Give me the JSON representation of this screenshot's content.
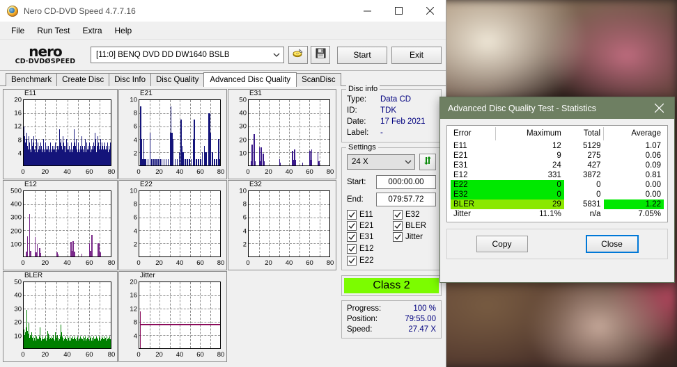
{
  "window": {
    "title": "Nero CD-DVD Speed 4.7.7.16",
    "icon": "nero-logo-icon",
    "controls": {
      "minimize": "minimize-icon",
      "maximize": "maximize-icon",
      "close": "close-icon"
    }
  },
  "menubar": {
    "items": [
      "File",
      "Run Test",
      "Extra",
      "Help"
    ]
  },
  "toolbar": {
    "logo_main": "nero",
    "logo_sub": "CD·DVDØSPEED",
    "drive": "[11:0]   BENQ DVD DD DW1640 BSLB",
    "eject_icon": "eject-disc-icon",
    "save_icon": "floppy-save-icon",
    "start_label": "Start",
    "exit_label": "Exit"
  },
  "tabs": {
    "items": [
      "Benchmark",
      "Create Disc",
      "Disc Info",
      "Disc Quality",
      "Advanced Disc Quality",
      "ScanDisc"
    ],
    "active": "Advanced Disc Quality"
  },
  "disc_info": {
    "legend": "Disc info",
    "rows": [
      {
        "key": "Type:",
        "value": "Data CD"
      },
      {
        "key": "ID:",
        "value": "TDK"
      },
      {
        "key": "Date:",
        "value": "17 Feb 2021"
      },
      {
        "key": "Label:",
        "value": "-"
      }
    ]
  },
  "settings": {
    "legend": "Settings",
    "speed": "24 X",
    "refresh_icon": "refresh-arrows-icon",
    "start_label": "Start:",
    "start_value": "000:00.00",
    "end_label": "End:",
    "end_value": "079:57.72",
    "checkboxes": [
      {
        "label": "E11",
        "checked": true
      },
      {
        "label": "E32",
        "checked": true
      },
      {
        "label": "E21",
        "checked": true
      },
      {
        "label": "BLER",
        "checked": true
      },
      {
        "label": "E31",
        "checked": true
      },
      {
        "label": "Jitter",
        "checked": true
      },
      {
        "label": "E12",
        "checked": true
      },
      {
        "label": "",
        "checked": null
      },
      {
        "label": "E22",
        "checked": true
      },
      {
        "label": "",
        "checked": null
      }
    ]
  },
  "class_badge": {
    "text": "Class 2",
    "color": "#7cfc00"
  },
  "progress": {
    "rows": [
      {
        "key": "Progress:",
        "value": "100 %"
      },
      {
        "key": "Position:",
        "value": "79:55.00"
      },
      {
        "key": "Speed:",
        "value": "27.47 X"
      }
    ]
  },
  "statistics_dialog": {
    "title": "Advanced Disc Quality Test - Statistics",
    "title_color": "#6e7f62",
    "close_icon": "close-icon",
    "columns": [
      "Error",
      "Maximum",
      "Total",
      "Average"
    ],
    "rows": [
      {
        "error": "E11",
        "maximum": "12",
        "total": "5129",
        "average": "1.07",
        "highlight": "none"
      },
      {
        "error": "E21",
        "maximum": "9",
        "total": "275",
        "average": "0.06",
        "highlight": "none"
      },
      {
        "error": "E31",
        "maximum": "24",
        "total": "427",
        "average": "0.09",
        "highlight": "none"
      },
      {
        "error": "E12",
        "maximum": "331",
        "total": "3872",
        "average": "0.81",
        "highlight": "none"
      },
      {
        "error": "E22",
        "maximum": "0",
        "total": "0",
        "average": "0.00",
        "highlight": "green-left"
      },
      {
        "error": "E32",
        "maximum": "0",
        "total": "0",
        "average": "0.00",
        "highlight": "green-left"
      },
      {
        "error": "BLER",
        "maximum": "29",
        "total": "5831",
        "average": "1.22",
        "highlight": "yellowgreen-left-green-avg"
      },
      {
        "error": "Jitter",
        "maximum": "11.1%",
        "total": "n/a",
        "average": "7.05%",
        "highlight": "none"
      }
    ],
    "copy_label": "Copy",
    "close_label": "Close",
    "colors": {
      "green": "#00e800",
      "yellow_green": "#8ae800"
    }
  },
  "chart_data": [
    {
      "type": "bar",
      "title": "E11",
      "xlabel": "",
      "ylabel": "",
      "ylim": [
        0,
        20
      ],
      "yticks": [
        4,
        8,
        12,
        16,
        20
      ],
      "xlim": [
        0,
        80
      ],
      "xticks": [
        0,
        20,
        40,
        60,
        80
      ],
      "color": "#14147a",
      "grid": true,
      "style": "dense-fill",
      "values": [
        12,
        9,
        7,
        5,
        8,
        10,
        6,
        5,
        9,
        7,
        6,
        5,
        4,
        8,
        6,
        5,
        7,
        9,
        5,
        4,
        6,
        8,
        5,
        4,
        7,
        5,
        6,
        4,
        5,
        7,
        6,
        4,
        5,
        8,
        6,
        5,
        4,
        7,
        5,
        6,
        4,
        5,
        6,
        4,
        5,
        7,
        6,
        4,
        5,
        6,
        5,
        4,
        6,
        5,
        7,
        4,
        5,
        6,
        4,
        5,
        6,
        11,
        7,
        5,
        8,
        6,
        5,
        9,
        7,
        6,
        5,
        4,
        6,
        8,
        5,
        4,
        7,
        5,
        6,
        4,
        5,
        7,
        6,
        4,
        5,
        6,
        11,
        7,
        5,
        6,
        8,
        5,
        4,
        6,
        7,
        5,
        4,
        6,
        5,
        7,
        9,
        6,
        5,
        4,
        6,
        8,
        5,
        4,
        7,
        5,
        6,
        4,
        5,
        7,
        6,
        4,
        5,
        6,
        4,
        5,
        7,
        6,
        10,
        8,
        5,
        4,
        6,
        9,
        7,
        5,
        4,
        6,
        8,
        5,
        7,
        6,
        4,
        5,
        6,
        7,
        5,
        4,
        6,
        5,
        7,
        4,
        6,
        5,
        4,
        7
      ]
    },
    {
      "type": "bar",
      "title": "E21",
      "xlabel": "",
      "ylabel": "",
      "ylim": [
        0,
        10
      ],
      "yticks": [
        2,
        4,
        6,
        8,
        10
      ],
      "xlim": [
        0,
        80
      ],
      "xticks": [
        0,
        20,
        40,
        60,
        80
      ],
      "color": "#14147a",
      "grid": true,
      "style": "sparse-spikes",
      "spikes": [
        [
          1,
          9
        ],
        [
          2,
          4
        ],
        [
          3,
          1
        ],
        [
          4,
          4
        ],
        [
          5,
          1
        ],
        [
          6,
          1
        ],
        [
          8,
          1
        ],
        [
          10,
          5
        ],
        [
          12,
          1
        ],
        [
          14,
          1
        ],
        [
          16,
          1
        ],
        [
          18,
          1
        ],
        [
          20,
          1
        ],
        [
          22,
          1
        ],
        [
          24,
          1
        ],
        [
          26,
          1
        ],
        [
          28,
          1
        ],
        [
          30,
          5
        ],
        [
          31,
          9
        ],
        [
          32,
          5
        ],
        [
          33,
          4
        ],
        [
          35,
          1
        ],
        [
          37,
          1
        ],
        [
          39,
          2
        ],
        [
          41,
          7
        ],
        [
          42,
          3
        ],
        [
          43,
          2
        ],
        [
          45,
          1
        ],
        [
          47,
          1
        ],
        [
          49,
          1
        ],
        [
          51,
          1
        ],
        [
          53,
          4
        ],
        [
          54,
          7
        ],
        [
          56,
          1
        ],
        [
          58,
          1
        ],
        [
          60,
          1
        ],
        [
          62,
          2
        ],
        [
          64,
          3
        ],
        [
          65,
          2
        ],
        [
          66,
          2
        ],
        [
          68,
          8
        ],
        [
          69,
          8
        ],
        [
          70,
          5
        ],
        [
          72,
          2
        ],
        [
          74,
          1
        ],
        [
          76,
          1
        ],
        [
          78,
          4
        ],
        [
          79,
          1
        ]
      ]
    },
    {
      "type": "bar",
      "title": "E31",
      "xlabel": "",
      "ylabel": "",
      "ylim": [
        0,
        50
      ],
      "yticks": [
        10,
        20,
        30,
        40,
        50
      ],
      "xlim": [
        0,
        80
      ],
      "xticks": [
        0,
        20,
        40,
        60,
        80
      ],
      "color": "#3a1a8a",
      "grid": true,
      "style": "sparse-spikes",
      "spikes": [
        [
          2,
          3
        ],
        [
          3,
          16
        ],
        [
          5,
          24
        ],
        [
          6,
          3
        ],
        [
          10,
          14
        ],
        [
          11,
          3
        ],
        [
          12,
          14
        ],
        [
          14,
          9
        ],
        [
          15,
          3
        ],
        [
          30,
          5
        ],
        [
          31,
          2
        ],
        [
          43,
          11
        ],
        [
          44,
          4
        ],
        [
          45,
          12
        ],
        [
          46,
          4
        ],
        [
          53,
          2
        ],
        [
          60,
          11
        ],
        [
          61,
          4
        ],
        [
          62,
          12
        ],
        [
          68,
          10
        ],
        [
          69,
          3
        ]
      ]
    },
    {
      "type": "bar",
      "title": "E12",
      "xlabel": "",
      "ylabel": "",
      "ylim": [
        0,
        500
      ],
      "yticks": [
        100,
        200,
        300,
        400,
        500
      ],
      "xlim": [
        0,
        80
      ],
      "xticks": [
        0,
        20,
        40,
        60,
        80
      ],
      "color": "#7a2a8a",
      "grid": true,
      "style": "sparse-spikes",
      "spikes": [
        [
          2,
          35
        ],
        [
          3,
          155
        ],
        [
          5,
          325
        ],
        [
          6,
          40
        ],
        [
          10,
          150
        ],
        [
          11,
          30
        ],
        [
          12,
          95
        ],
        [
          14,
          65
        ],
        [
          15,
          25
        ],
        [
          30,
          30
        ],
        [
          31,
          15
        ],
        [
          43,
          110
        ],
        [
          44,
          40
        ],
        [
          45,
          118
        ],
        [
          46,
          35
        ],
        [
          53,
          20
        ],
        [
          60,
          100
        ],
        [
          61,
          40
        ],
        [
          62,
          165
        ],
        [
          68,
          100
        ],
        [
          69,
          100
        ],
        [
          70,
          30
        ]
      ]
    },
    {
      "type": "bar",
      "title": "E22",
      "xlabel": "",
      "ylabel": "",
      "ylim": [
        0,
        10
      ],
      "yticks": [
        2,
        4,
        6,
        8,
        10
      ],
      "xlim": [
        0,
        80
      ],
      "xticks": [
        0,
        20,
        40,
        60,
        80
      ],
      "color": "#14147a",
      "grid": true,
      "style": "empty",
      "spikes": []
    },
    {
      "type": "bar",
      "title": "E32",
      "xlabel": "",
      "ylabel": "",
      "ylim": [
        0,
        10
      ],
      "yticks": [
        2,
        4,
        6,
        8,
        10
      ],
      "xlim": [
        0,
        80
      ],
      "xticks": [
        0,
        20,
        40,
        60,
        80
      ],
      "color": "#14147a",
      "grid": true,
      "style": "empty",
      "spikes": []
    },
    {
      "type": "bar",
      "title": "BLER",
      "xlabel": "",
      "ylabel": "",
      "ylim": [
        0,
        50
      ],
      "yticks": [
        10,
        20,
        30,
        40,
        50
      ],
      "xlim": [
        0,
        80
      ],
      "xticks": [
        0,
        20,
        40,
        60,
        80
      ],
      "color": "#008000",
      "grid": true,
      "style": "dense-fill",
      "values": [
        14,
        10,
        8,
        12,
        16,
        29,
        13,
        9,
        11,
        19,
        8,
        10,
        7,
        9,
        12,
        8,
        7,
        9,
        6,
        8,
        10,
        7,
        6,
        9,
        7,
        8,
        6,
        7,
        9,
        6,
        16,
        8,
        6,
        7,
        9,
        6,
        7,
        8,
        6,
        7,
        9,
        6,
        8,
        12,
        13,
        11,
        9,
        7,
        8,
        6,
        7,
        9,
        6,
        8,
        10,
        7,
        6,
        8,
        12,
        9,
        8,
        10,
        7,
        6,
        8,
        7,
        9,
        6,
        18,
        12,
        9,
        7,
        8,
        6,
        7,
        9,
        6,
        8,
        7,
        6,
        9,
        7,
        8,
        6,
        7,
        9,
        6,
        8,
        7,
        9,
        6,
        7,
        8,
        6,
        9,
        7,
        6,
        8,
        7,
        9,
        6,
        8,
        7,
        6,
        9,
        7,
        8,
        6,
        7,
        9,
        6,
        8,
        7,
        9,
        6,
        7,
        8,
        6,
        9,
        7,
        6,
        8,
        7,
        9,
        6,
        7,
        8,
        6,
        9,
        7,
        8,
        6,
        7,
        9,
        6,
        8,
        7,
        6,
        9,
        7,
        8,
        6,
        7,
        9,
        6,
        8,
        7,
        9,
        6,
        7,
        8,
        6,
        9,
        7,
        6,
        8,
        7,
        9,
        6,
        7
      ]
    },
    {
      "type": "line",
      "title": "Jitter",
      "xlabel": "",
      "ylabel": "",
      "ylim": [
        0,
        20
      ],
      "yticks": [
        4,
        8,
        12,
        16,
        20
      ],
      "xlim": [
        0,
        80
      ],
      "xticks": [
        0,
        20,
        40,
        60,
        80
      ],
      "color": "#8a0a5a",
      "grid": true,
      "style": "flat-line",
      "level": 7.0,
      "leading_spike": 11.1
    }
  ]
}
